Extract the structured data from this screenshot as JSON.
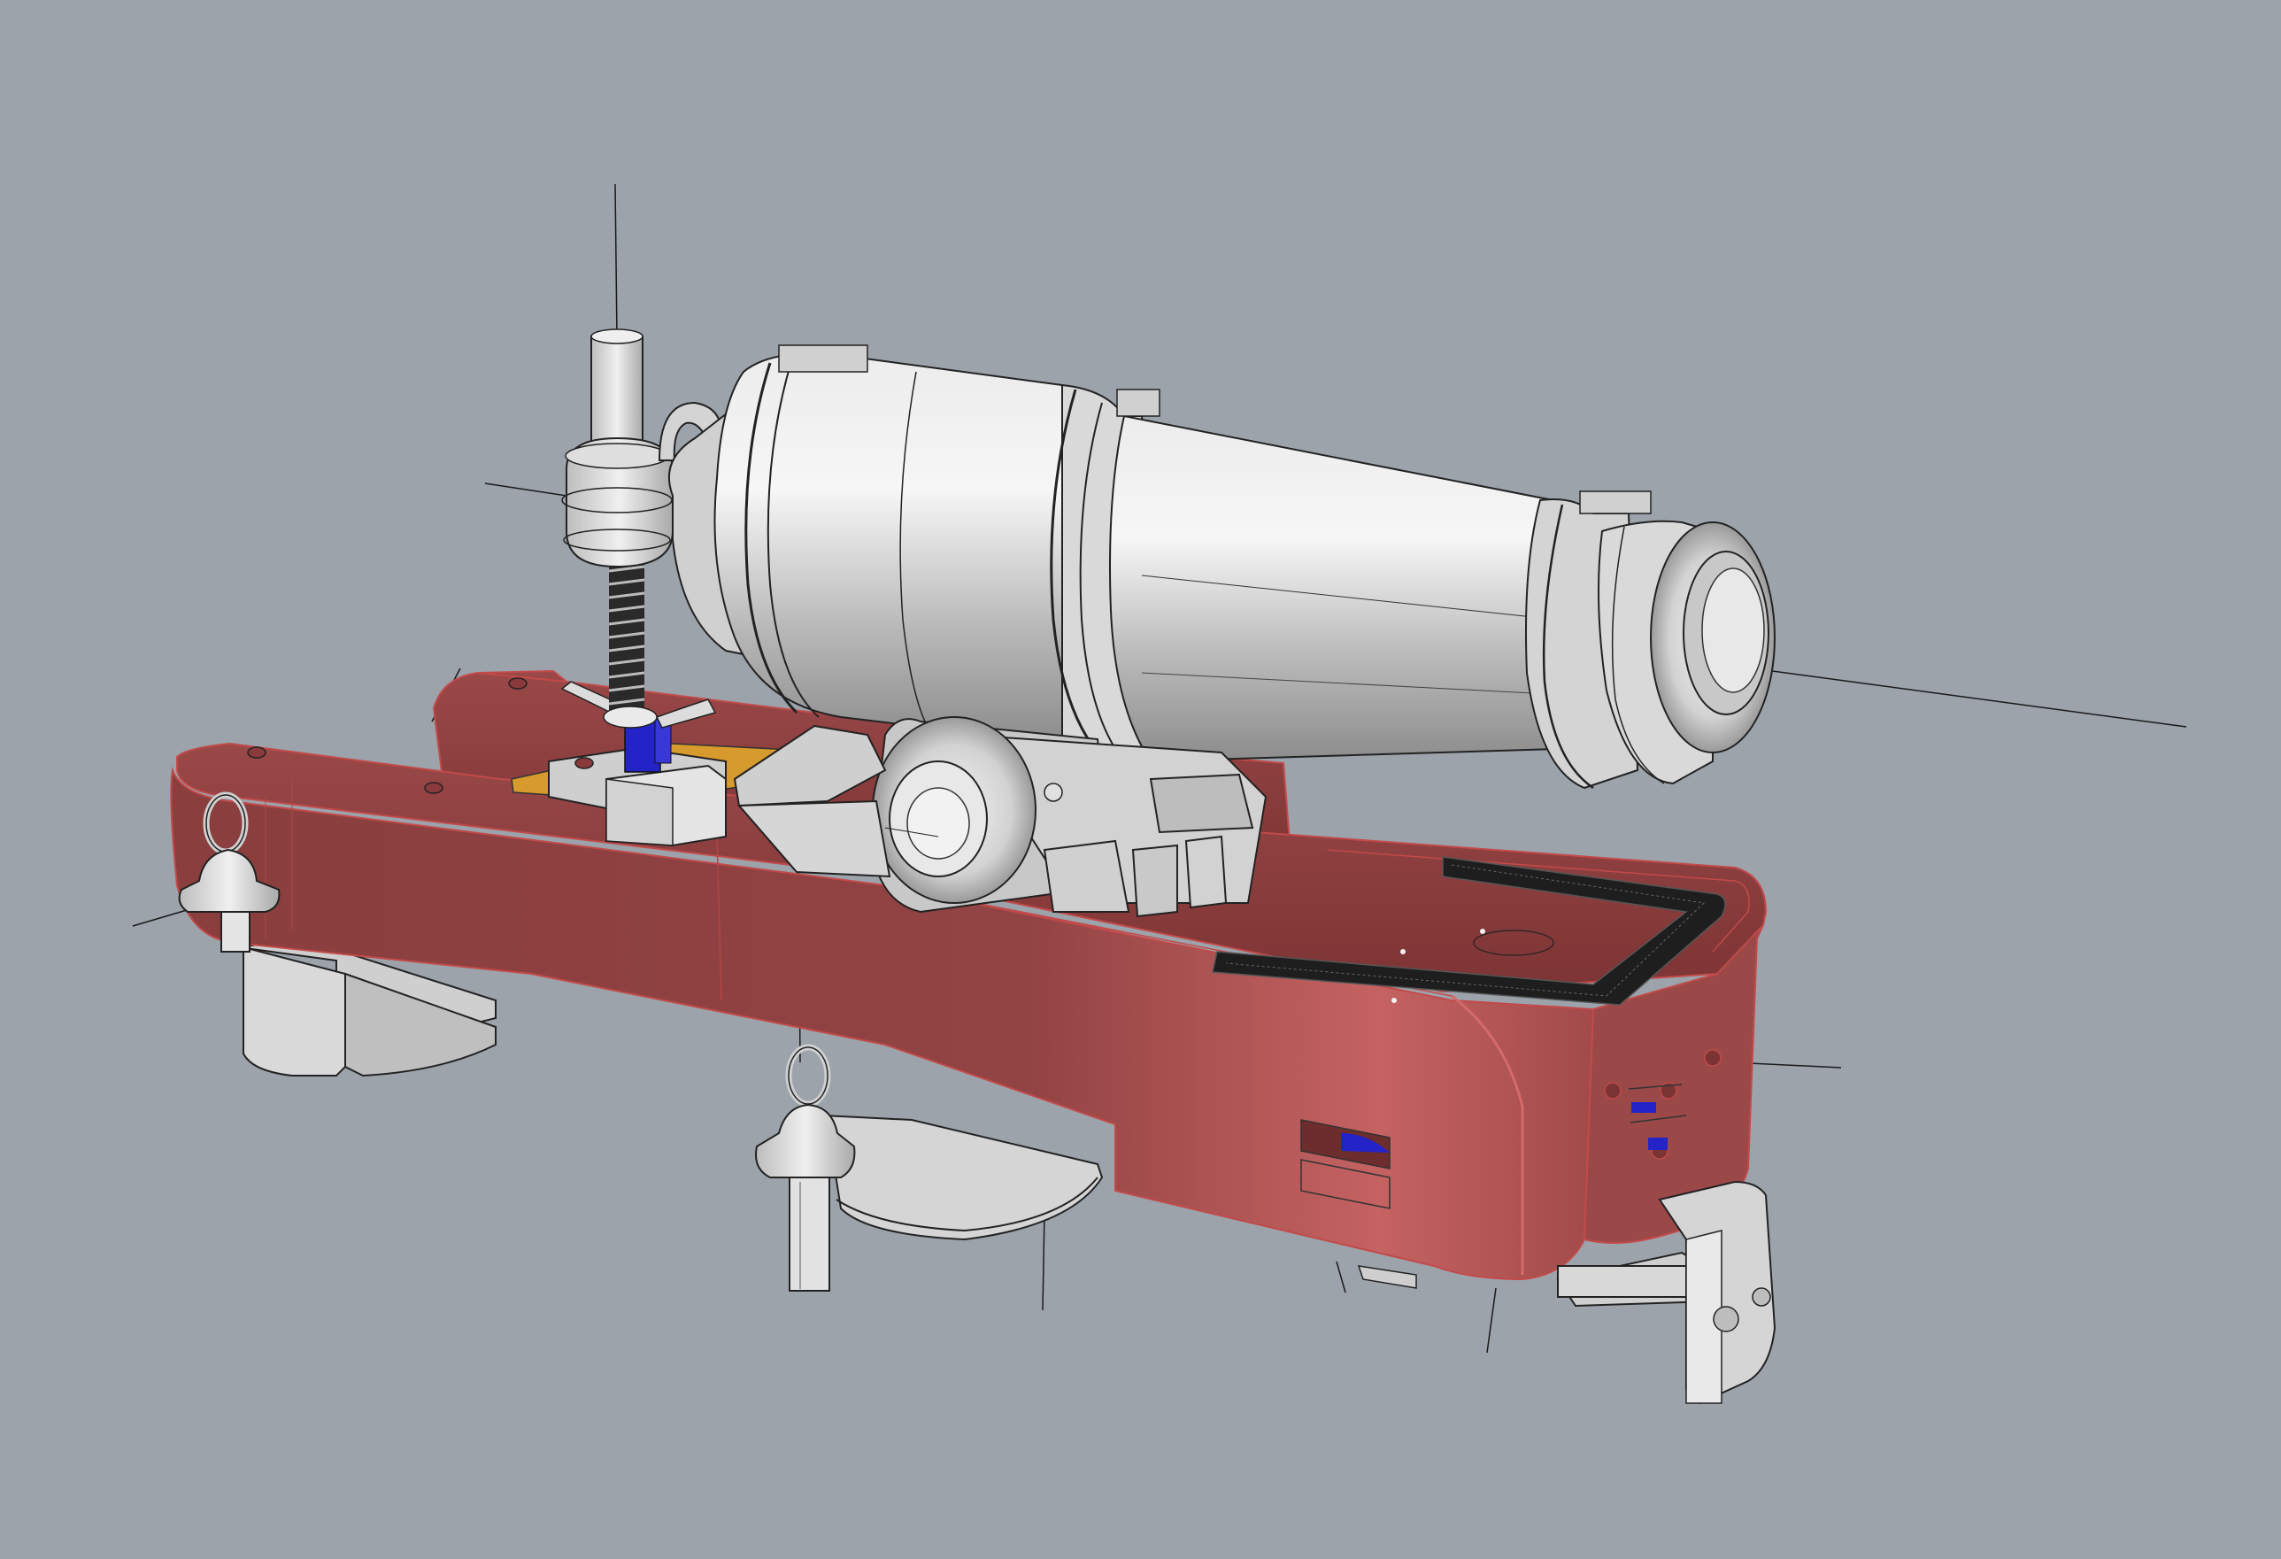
{
  "viewport": {
    "background": "#9ca3ab",
    "display_mode": "rendered-with-edges",
    "model": {
      "carriage_color": "#8b3f3f",
      "carriage_edge_color": "#c24a4a",
      "metal_color": "#d5d5d5",
      "metal_edge_color": "#2a2a2a",
      "selected_color": "#2323c8",
      "wedge_color": "#d79a2c",
      "track_color": "#1e1e1e"
    },
    "parts": [
      {
        "name": "barrel",
        "icon": "cylinder"
      },
      {
        "name": "trunnion",
        "icon": "cylinder"
      },
      {
        "name": "carriage-body",
        "icon": "box"
      },
      {
        "name": "elevation-screw",
        "icon": "screw"
      },
      {
        "name": "elevation-block",
        "icon": "box"
      },
      {
        "name": "quoin-wedge",
        "icon": "box"
      },
      {
        "name": "track-rail",
        "icon": "curve"
      },
      {
        "name": "ring-bolt",
        "icon": "ring"
      },
      {
        "name": "wheel-bracket",
        "icon": "bracket"
      }
    ]
  }
}
